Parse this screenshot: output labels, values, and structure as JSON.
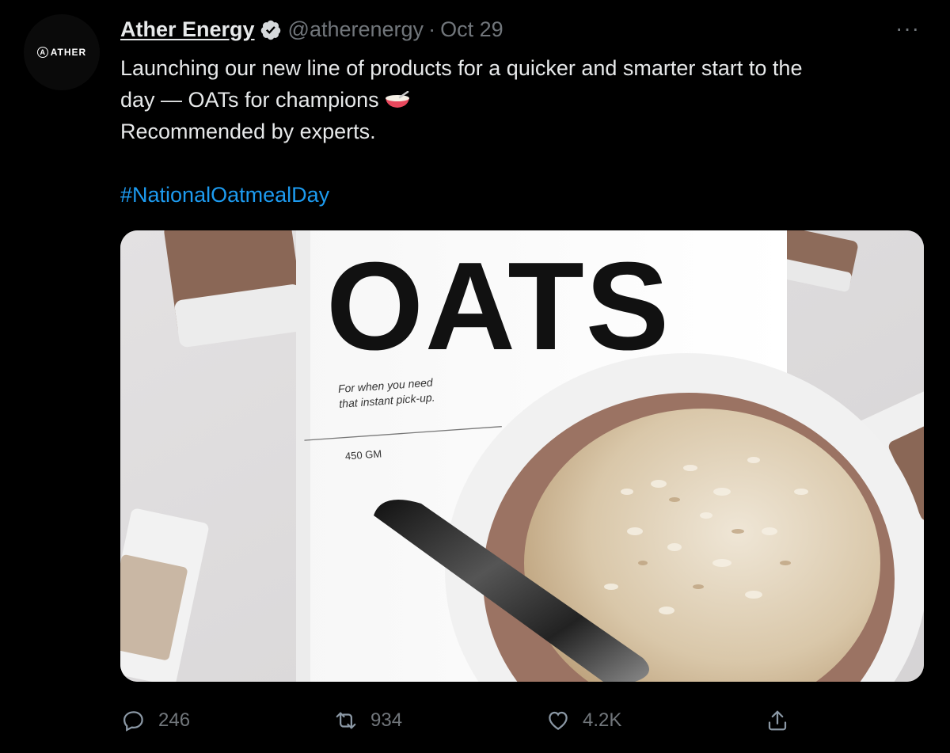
{
  "tweet": {
    "author": {
      "name": "Ather Energy",
      "handle": "@atherenergy",
      "avatar_logo_text": "ATHER",
      "verified": true
    },
    "separator": "·",
    "date": "Oct 29",
    "more_label": "···",
    "text_lines": [
      "Launching our new line of products for a quicker and smarter start to the",
      "day — OATs for champions",
      "Recommended by experts."
    ],
    "hashtag": "#NationalOatmealDay",
    "media": {
      "packet_title": "OATS",
      "packet_tagline_1": "For when you need",
      "packet_tagline_2": "that instant pick-up.",
      "packet_weight": "450 GM"
    },
    "actions": {
      "replies": "246",
      "retweets": "934",
      "likes": "4.2K"
    }
  },
  "colors": {
    "background": "#000000",
    "text": "#e7e9ea",
    "muted": "#71767b",
    "link": "#1d9bf0"
  },
  "icons": [
    "verified-badge-icon",
    "more-icon",
    "bowl-emoji-icon",
    "reply-icon",
    "retweet-icon",
    "like-icon",
    "share-icon"
  ]
}
